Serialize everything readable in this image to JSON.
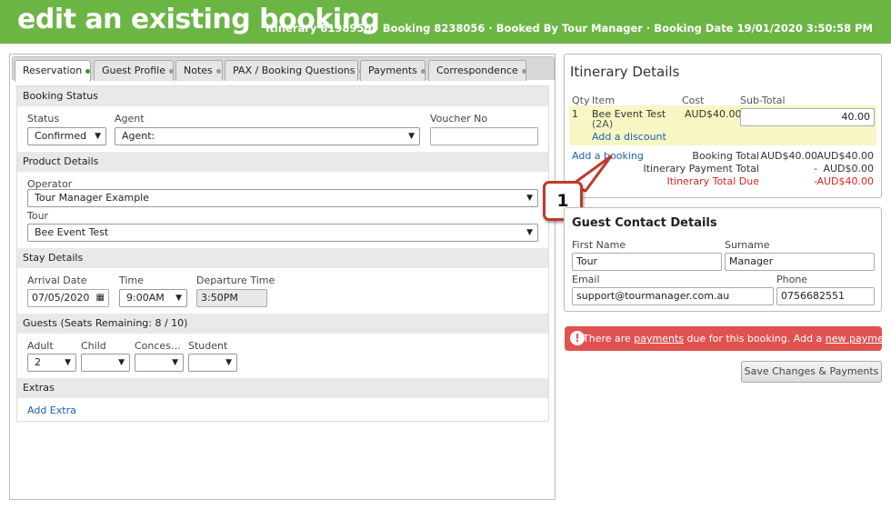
{
  "header": {
    "title": "edit an existing booking",
    "meta": "Itinerary 8198950 · Booking 8238056 · Booked By Tour Manager · Booking Date 19/01/2020 3:50:58 PM"
  },
  "tabs": [
    {
      "label": "Reservation",
      "active": true
    },
    {
      "label": "Guest Profile"
    },
    {
      "label": "Notes"
    },
    {
      "label": "PAX / Booking Questions"
    },
    {
      "label": "Payments"
    },
    {
      "label": "Correspondence"
    }
  ],
  "booking_status": {
    "header": "Booking Status",
    "status_label": "Status",
    "status_value": "Confirmed",
    "agent_label": "Agent",
    "agent_value": "Agent:",
    "voucher_label": "Voucher No",
    "voucher_value": ""
  },
  "product": {
    "header": "Product Details",
    "operator_label": "Operator",
    "operator_value": "Tour Manager Example",
    "tour_label": "Tour",
    "tour_value": "Bee Event Test"
  },
  "stay": {
    "header": "Stay Details",
    "arrival_label": "Arrival Date",
    "arrival_value": "07/05/2020",
    "time_label": "Time",
    "time_value": "9:00AM",
    "departure_label": "Departure Time",
    "departure_value": "3:50PM"
  },
  "guests": {
    "header": "Guests (Seats Remaining: 8 / 10)",
    "adult_label": "Adult",
    "adult_value": "2",
    "child_label": "Child",
    "child_value": "",
    "concession_label": "Conces…",
    "concession_value": "",
    "student_label": "Student",
    "student_value": ""
  },
  "extras": {
    "header": "Extras",
    "add_extra": "Add Extra"
  },
  "itinerary": {
    "title": "Itinerary Details",
    "col_qty": "Qty",
    "col_item": "Item",
    "col_cost": "Cost",
    "col_subtotal": "Sub-Total",
    "row": {
      "qty": "1",
      "item": "Bee Event Test",
      "item_sub": "(2A)",
      "cost": "AUD$40.00",
      "subtotal": "40.00"
    },
    "add_discount": "Add a discount",
    "add_booking": "Add a booking",
    "booking_total_label": "Booking Total",
    "booking_total_a": "AUD$40.00",
    "booking_total_b": "AUD$40.00",
    "payment_total_label": "Itinerary Payment Total",
    "payment_total_a": "-",
    "payment_total_b": "AUD$0.00",
    "due_label": "Itinerary Total Due",
    "due_a": "-",
    "due_b": "AUD$40.00"
  },
  "callout": "1",
  "contact": {
    "title": "Guest Contact Details",
    "first_label": "First Name",
    "first_value": "Tour",
    "surname_label": "Surname",
    "surname_value": "Manager",
    "email_label": "Email",
    "email_value": "support@tourmanager.com.au",
    "phone_label": "Phone",
    "phone_value": "0756682551"
  },
  "alert": {
    "pre": "There are ",
    "link1": "payments",
    "mid": " due for this booking. Add a ",
    "link2": "new payment",
    "post": "?"
  },
  "save_button": "Save Changes & Payments",
  "colors": {
    "header_green": "#6bb544",
    "alert_red": "#e05250",
    "link_blue": "#1a5fb4",
    "highlight_yellow": "#f7f7c4",
    "due_red": "#d9261c"
  }
}
